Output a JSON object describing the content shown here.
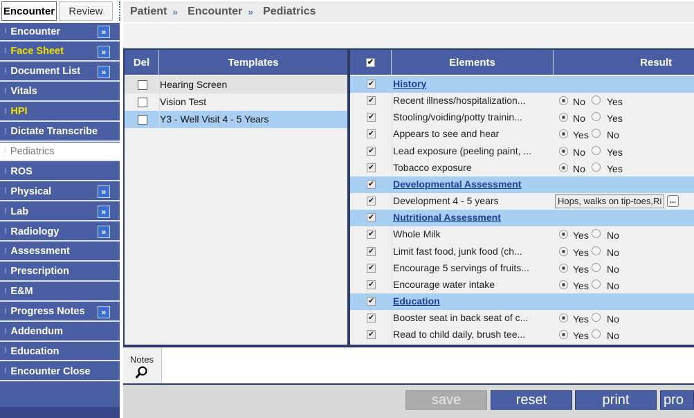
{
  "tabs": {
    "encounter": "Encounter",
    "review": "Review"
  },
  "breadcrumb": {
    "items": [
      "Patient",
      "Encounter",
      "Pediatrics"
    ],
    "separator": "»"
  },
  "sidebar": {
    "items": [
      {
        "label": "Encounter",
        "expand": "»"
      },
      {
        "label": "Face Sheet",
        "expand": "»",
        "highlight": true
      },
      {
        "label": "Document List",
        "expand": "»"
      },
      {
        "label": "Vitals"
      },
      {
        "label": "HPI",
        "highlight": true
      },
      {
        "label": "Dictate Transcribe"
      },
      {
        "label": "Pediatrics",
        "active": true
      },
      {
        "label": "ROS"
      },
      {
        "label": "Physical",
        "expand": "»"
      },
      {
        "label": "Lab",
        "expand": "»"
      },
      {
        "label": "Radiology",
        "expand": "»"
      },
      {
        "label": "Assessment"
      },
      {
        "label": "Prescription"
      },
      {
        "label": "E&M"
      },
      {
        "label": "Progress Notes",
        "expand": "»"
      },
      {
        "label": "Addendum"
      },
      {
        "label": "Education"
      },
      {
        "label": "Encounter Close"
      }
    ]
  },
  "templates": {
    "header_del": "Del",
    "header_templates": "Templates",
    "rows": [
      {
        "name": "Hearing Screen",
        "checked": false
      },
      {
        "name": "Vision Test",
        "checked": false
      },
      {
        "name": "Y3 - Well Visit 4 - 5 Years",
        "checked": false,
        "selected": true
      }
    ]
  },
  "elements": {
    "header_check": "✔",
    "header_elements": "Elements",
    "header_result": "Result",
    "rows": [
      {
        "type": "section",
        "label": "History"
      },
      {
        "type": "item",
        "label": "Recent illness/hospitalization...",
        "opt1": "No",
        "opt2": "Yes",
        "selected": 1
      },
      {
        "type": "item",
        "label": "Stooling/voiding/potty trainin...",
        "opt1": "No",
        "opt2": "Yes",
        "selected": 1
      },
      {
        "type": "item",
        "label": "Appears to see and hear",
        "opt1": "Yes",
        "opt2": "No",
        "selected": 1
      },
      {
        "type": "item",
        "label": "Lead exposure (peeling paint, ...",
        "opt1": "No",
        "opt2": "Yes",
        "selected": 1
      },
      {
        "type": "item",
        "label": "Tobacco exposure",
        "opt1": "No",
        "opt2": "Yes",
        "selected": 1
      },
      {
        "type": "section",
        "label": "Developmental Assessment"
      },
      {
        "type": "text",
        "label": "Development 4 - 5 years",
        "value": "Hops, walks on tip-toes,Ri",
        "button": "..."
      },
      {
        "type": "section",
        "label": "Nutritional Assessment"
      },
      {
        "type": "item",
        "label": "Whole Milk",
        "opt1": "Yes",
        "opt2": "No",
        "selected": 1
      },
      {
        "type": "item",
        "label": "Limit fast food, junk food (ch...",
        "opt1": "Yes",
        "opt2": "No",
        "selected": 1
      },
      {
        "type": "item",
        "label": "Encourage 5 servings of fruits...",
        "opt1": "Yes",
        "opt2": "No",
        "selected": 1
      },
      {
        "type": "item",
        "label": "Encourage water intake",
        "opt1": "Yes",
        "opt2": "No",
        "selected": 1
      },
      {
        "type": "section",
        "label": "Education"
      },
      {
        "type": "item",
        "label": "Booster seat in back seat of c...",
        "opt1": "Yes",
        "opt2": "No",
        "selected": 1
      },
      {
        "type": "item",
        "label": "Read to child daily, brush tee...",
        "opt1": "Yes",
        "opt2": "No",
        "selected": 1
      }
    ]
  },
  "notes": {
    "label": "Notes",
    "icon": "magnifier-icon"
  },
  "buttons": {
    "save": "save",
    "reset": "reset",
    "print": "print",
    "next": "pro"
  }
}
